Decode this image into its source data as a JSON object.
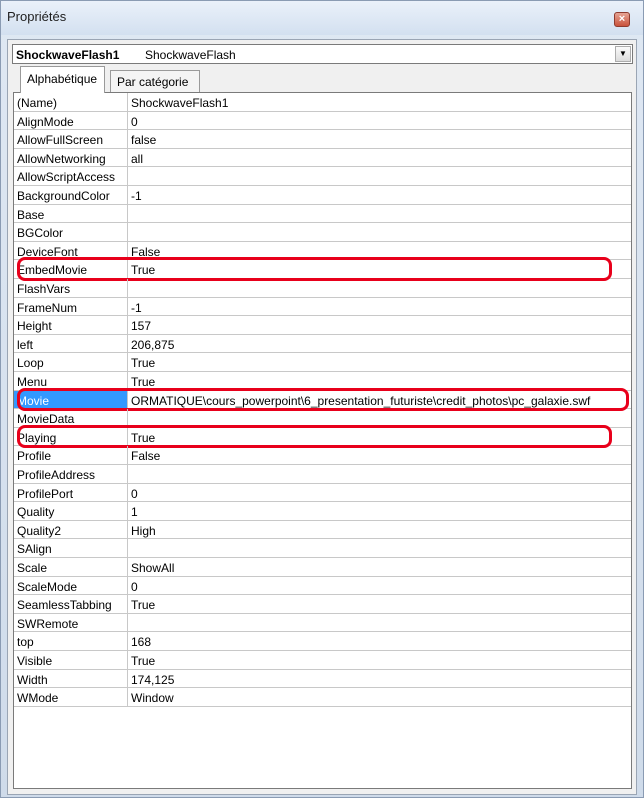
{
  "window": {
    "title": "Propriétés",
    "close_glyph": "×"
  },
  "object_select": {
    "name": "ShockwaveFlash1",
    "type": "ShockwaveFlash",
    "arrow": "▼"
  },
  "tabs": [
    {
      "label": "Alphabétique",
      "active": true
    },
    {
      "label": "Par catégorie",
      "active": false
    }
  ],
  "properties": [
    {
      "name": "(Name)",
      "value": "ShockwaveFlash1"
    },
    {
      "name": "AlignMode",
      "value": "0"
    },
    {
      "name": "AllowFullScreen",
      "value": "false"
    },
    {
      "name": "AllowNetworking",
      "value": "all"
    },
    {
      "name": "AllowScriptAccess",
      "value": ""
    },
    {
      "name": "BackgroundColor",
      "value": "-1"
    },
    {
      "name": "Base",
      "value": ""
    },
    {
      "name": "BGColor",
      "value": ""
    },
    {
      "name": "DeviceFont",
      "value": "False"
    },
    {
      "name": "EmbedMovie",
      "value": "True"
    },
    {
      "name": "FlashVars",
      "value": ""
    },
    {
      "name": "FrameNum",
      "value": "-1"
    },
    {
      "name": "Height",
      "value": "157"
    },
    {
      "name": "left",
      "value": "206,875"
    },
    {
      "name": "Loop",
      "value": "True"
    },
    {
      "name": "Menu",
      "value": "True"
    },
    {
      "name": "Movie",
      "value": "ORMATIQUE\\cours_powerpoint\\6_presentation_futuriste\\credit_photos\\pc_galaxie.swf"
    },
    {
      "name": "MovieData",
      "value": ""
    },
    {
      "name": "Playing",
      "value": "True"
    },
    {
      "name": "Profile",
      "value": "False"
    },
    {
      "name": "ProfileAddress",
      "value": ""
    },
    {
      "name": "ProfilePort",
      "value": "0"
    },
    {
      "name": "Quality",
      "value": "1"
    },
    {
      "name": "Quality2",
      "value": "High"
    },
    {
      "name": "SAlign",
      "value": ""
    },
    {
      "name": "Scale",
      "value": "ShowAll"
    },
    {
      "name": "ScaleMode",
      "value": "0"
    },
    {
      "name": "SeamlessTabbing",
      "value": "True"
    },
    {
      "name": "SWRemote",
      "value": ""
    },
    {
      "name": "top",
      "value": "168"
    },
    {
      "name": "Visible",
      "value": "True"
    },
    {
      "name": "Width",
      "value": "174,125"
    },
    {
      "name": "WMode",
      "value": "Window"
    }
  ],
  "selected_property": "Movie",
  "highlighted_properties": [
    "EmbedMovie",
    "Movie",
    "Playing"
  ],
  "colors": {
    "selection": "#3399ff",
    "highlight_outline": "#e8001b"
  }
}
